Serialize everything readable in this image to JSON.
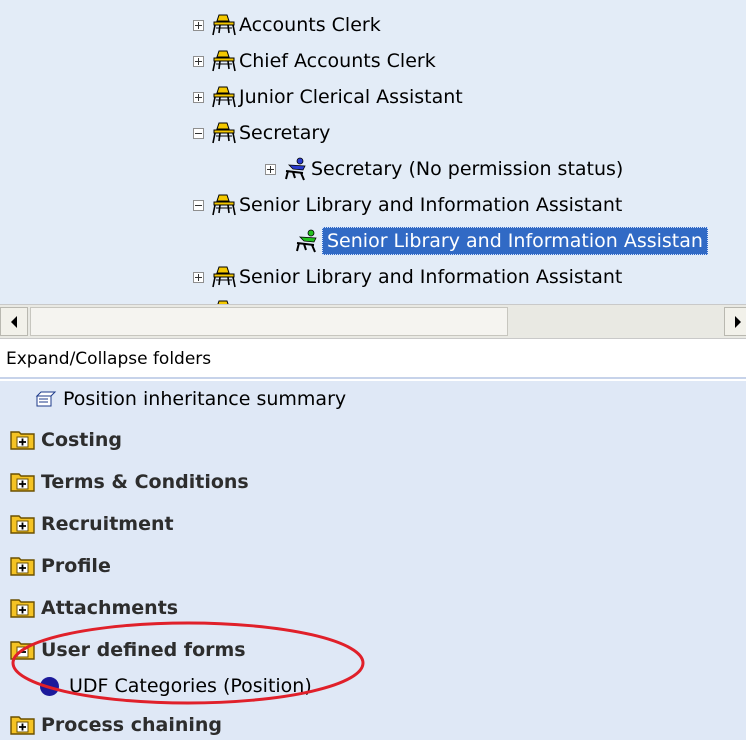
{
  "tree": {
    "nodes": [
      {
        "label": "Accounts Clerk",
        "toggle": "plus",
        "icon": "position-chair-icon"
      },
      {
        "label": "Chief Accounts Clerk",
        "toggle": "plus",
        "icon": "position-chair-icon"
      },
      {
        "label": "Junior Clerical Assistant",
        "toggle": "plus",
        "icon": "position-chair-icon"
      },
      {
        "label": "Secretary",
        "toggle": "minus",
        "icon": "position-chair-icon"
      },
      {
        "label": "Secretary (No permission status)",
        "toggle": "plus",
        "icon": "blue-person-icon"
      },
      {
        "label": "Senior Library and Information Assistant",
        "toggle": "minus",
        "icon": "position-chair-icon"
      },
      {
        "label": "Senior Library and Information Assistan",
        "toggle": "none",
        "icon": "green-person-icon",
        "selected": true
      },
      {
        "label": "Senior Library and Information Assistant",
        "toggle": "plus",
        "icon": "position-chair-icon"
      }
    ]
  },
  "expand_collapse_label": "Expand/Collapse folders",
  "panel": {
    "summary_label": "Position inheritance summary",
    "folders": [
      "Costing",
      "Terms & Conditions",
      "Recruitment",
      "Profile",
      "Attachments",
      "User defined forms"
    ],
    "udf_item": "UDF Categories (Position)",
    "last_folder": "Process chaining"
  },
  "colors": {
    "tree_bg": "#e3ecf7",
    "selection": "#316ac5",
    "panel_bg": "#dfe8f6",
    "folder_yellow": "#f5c324",
    "highlight_oval": "#e0202a",
    "bullet": "#1c1a9b"
  }
}
